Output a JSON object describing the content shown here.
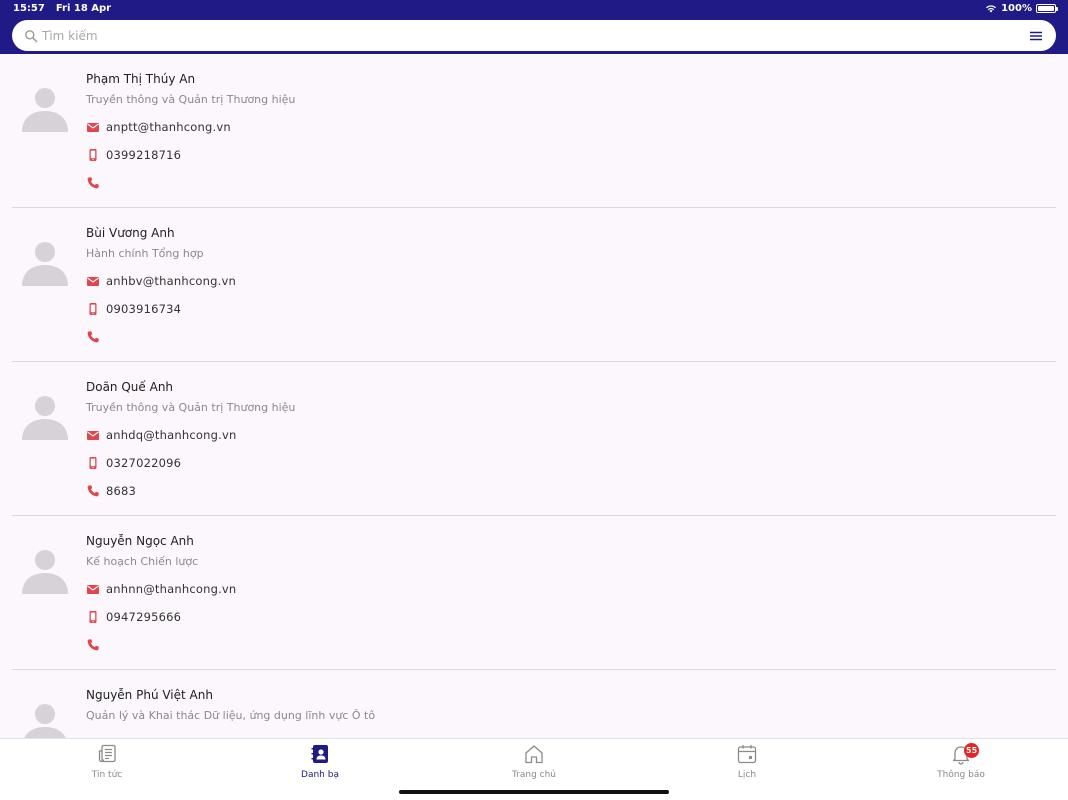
{
  "status_bar": {
    "time": "15:57",
    "date": "Fri 18 Apr",
    "battery": "100%",
    "battery_level": 1.0
  },
  "search": {
    "placeholder": "Tìm kiếm",
    "value": ""
  },
  "contacts": [
    {
      "name": "Phạm Thị Thúy An",
      "department": "Truyền thông và Quản trị Thương hiệu",
      "email": "anptt@thanhcong.vn",
      "mobile": "0399218716",
      "phone": ""
    },
    {
      "name": "Bùi Vương Anh",
      "department": "Hành chính Tổng hợp",
      "email": "anhbv@thanhcong.vn",
      "mobile": "0903916734",
      "phone": ""
    },
    {
      "name": "Doãn Quế Anh",
      "department": "Truyền thông và Quản trị Thương hiệu",
      "email": "anhdq@thanhcong.vn",
      "mobile": "0327022096",
      "phone": "8683"
    },
    {
      "name": "Nguyễn Ngọc Anh",
      "department": "Kế hoạch Chiến lược",
      "email": "anhnn@thanhcong.vn",
      "mobile": "0947295666",
      "phone": ""
    },
    {
      "name": "Nguyễn Phú Việt Anh",
      "department": "Quản lý và Khai thác Dữ liệu, ứng dụng lĩnh vực Ô tô",
      "email": "",
      "mobile": "",
      "phone": ""
    }
  ],
  "tabs": [
    {
      "label": "Tin tức",
      "icon": "news-icon"
    },
    {
      "label": "Danh bạ",
      "icon": "contacts-icon",
      "active": true
    },
    {
      "label": "Trang chủ",
      "icon": "home-icon"
    },
    {
      "label": "Lịch",
      "icon": "calendar-icon"
    },
    {
      "label": "Thông báo",
      "icon": "bell-icon",
      "badge": "55"
    }
  ],
  "colors": {
    "header": "#1f1a85",
    "accent": "#e0464b",
    "background": "#fcf6fd",
    "badge": "#e52521"
  }
}
